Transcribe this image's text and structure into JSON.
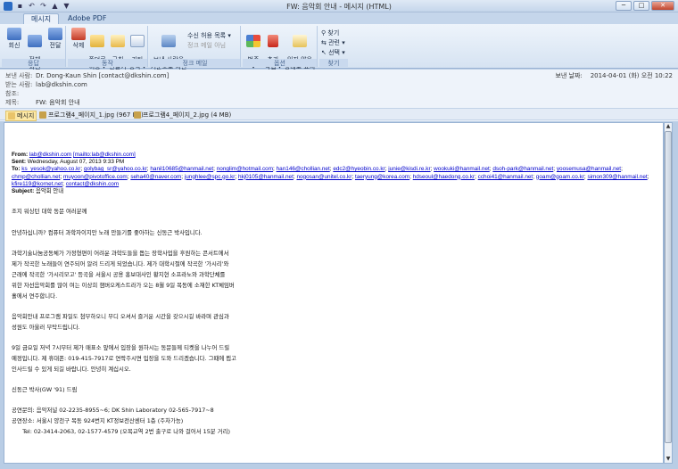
{
  "window": {
    "title": "FW: 음악회 안내 - 메시지 (HTML)",
    "minimize": "─",
    "maximize": "□",
    "close": "✕"
  },
  "tabs": [
    "메시지",
    "Adobe PDF"
  ],
  "ribbon": {
    "groups": [
      {
        "label": "응답",
        "buttons": [
          "회신",
          "전체\n회신",
          "전달"
        ]
      },
      {
        "label": "동작",
        "buttons": [
          "삭제",
          "폴더로\n이동 ▾",
          "규칙\n만들기 ▾",
          "기타\n동작 ▾"
        ]
      },
      {
        "label": "정크 메일",
        "buttons": [
          "보낸 사람을\n기준으로 차단"
        ],
        "small": [
          "수신 허용 목록 ▾",
          "정크 메일 아님"
        ]
      },
      {
        "label": "옵션",
        "buttons": [
          "범주\n▾",
          "추가\n작업 ▾",
          "읽지 않은\n상태로 표시"
        ]
      },
      {
        "label": "찾기",
        "small": [
          "찾기",
          "관련 ▾",
          "선택 ▾"
        ]
      }
    ]
  },
  "header": {
    "from_label": "보낸 사람:",
    "from_value": "Dr. Dong-Kaun Shin [contact@dkshin.com]",
    "to_label": "받는 사람:",
    "to_value": "lab@dkshin.com",
    "cc_label": "참조:",
    "cc_value": "",
    "subject_label": "제목:",
    "subject_value": "FW: 음악회 안내",
    "sent_label": "보낸 날짜:",
    "sent_value": "2014-04-01 (화) 오전 10:22"
  },
  "attachments": [
    {
      "name": "메시지",
      "selected": true
    },
    {
      "name": "프로그램4_페이지_1.jpg (967 KB)",
      "selected": false
    },
    {
      "name": "프로그램4_페이지_2.jpg (4 MB)",
      "selected": false
    }
  ],
  "mail": {
    "from_label": "From:",
    "from_email": "lab@dkshin.com",
    "from_mailto": "[mailto:lab@dkshin.com]",
    "sent_label": "Sent:",
    "sent_value": "Wednesday, August 07, 2013 9:33 PM",
    "to_label": "To:",
    "to_emails": [
      "ks_yesok@yahoo.co.kr",
      "golybag_sr@yahoo.co.kr",
      "hanil10685@hanmail.net",
      "nonglim@hotmail.com",
      "han146@chollian.net",
      "edc2@hyeobin.co.kr",
      "junie@kisdi.re.kr",
      "wookuki@hanmail.net",
      "dsoh-park@hanmail.net",
      "yoosemusa@hanmail.net",
      "chmp@chollian.net",
      "muyoon@pivotoffice.com",
      "seha40@naver.com",
      "junghlee@spc.go.kr",
      "hkj0105@hanmail.net",
      "nogosan@unitel.co.kr",
      "taeryung@korea.com",
      "hdseoul@haedong.co.kr",
      "cchoi41@hanmail.net",
      "goam@goam.co.kr",
      "simon309@hanmail.net",
      "kfire119@kornet.net",
      "contact@dkshin.com"
    ],
    "subject_label": "Subject:",
    "subject_value": "음악회 안내",
    "body": [
      "조지 워싱턴 대학 동문 여러분께",
      "안녕하십니까? 컴퓨터 과학자이지만 노래 만들기를 좋아하는 신동근 박사입니다.",
      "과학기술나눔공동체가 가정형편이 어려운 과학도들을 돕는 장학사업을 후원하는 콘서트에서",
      "제가 작곡한 노래들이 연주되어 알려 드리게 되었습니다. 제가 대학시절에 작곡한 '가시리'와",
      "근래에 작곡한 '가시리모고' 등곡을 서울시 공용 홍보대사인 황지현 소프라노와 과학단체를",
      "위한 자선음악회를 많이 여는 이상희 챔버오케스트라가 오는 8월 9일 목동에 소재한 KT체임버",
      "홀에서 연주합니다.",
      "음악회안내 프로그램 파일도 첨부하오니 부디 오셔서 즐거운 시간을 갖으시길 바라며 관심과",
      "성원도 아울러 부탁드립니다.",
      "9일 금요일 저녁 7시부터 제가 매표소 앞에서 입장을 원하시는 동문들께 티켓을 나누어 드릴",
      "예정입니다. 제 휴대폰: 019-415-7917로 연락주시면 입장을 도와 드리겠습니다. 그때에 뵙고",
      "인사드릴 수 있게 되길 바랍니다. 안녕히 계십시오.",
      "신동근 박사(GW '91) 드림",
      "공연문의: 음악저널 02-2235-8955~6; DK Shin Laboratory 02-565-7917~8",
      "공연장소: 서울시 양천구 목동 924번지 KT정보전산센터 1층 (주차가능)",
      "      Tel: 02-3414-2063, 02-1577-4579 (오목교역 2번 출구로 나와 걸어서 15분 거리)"
    ]
  }
}
